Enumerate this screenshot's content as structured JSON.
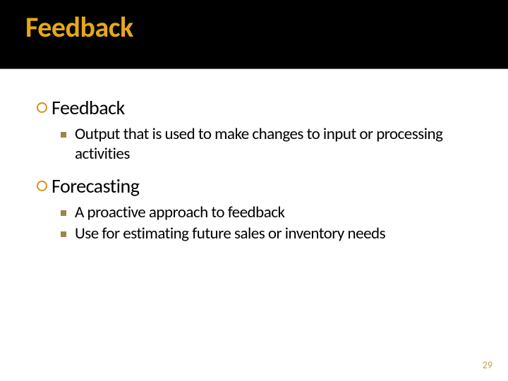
{
  "title": "Feedback",
  "sections": [
    {
      "heading": "Feedback",
      "items": [
        "Output that is used to make changes to input or processing activities"
      ]
    },
    {
      "heading": "Forecasting",
      "items": [
        "A proactive approach to feedback",
        "Use for estimating future sales or inventory needs"
      ]
    }
  ],
  "page_number": "29"
}
